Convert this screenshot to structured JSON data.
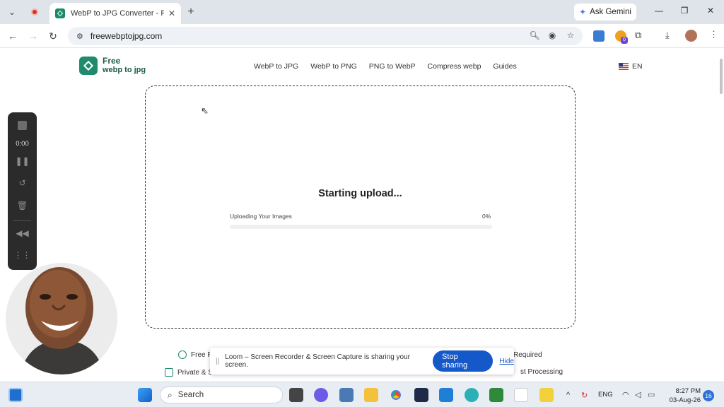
{
  "browser": {
    "tab_title": "WebP to JPG Converter - Free, f",
    "tab_close": "✕",
    "new_tab": "+",
    "gemini_label": "Ask Gemini",
    "url": "freewebptojpg.com",
    "window_controls": {
      "minimize": "—",
      "restore": "❐",
      "close": "✕"
    },
    "ext_badge": "0"
  },
  "site": {
    "logo_line1": "Free",
    "logo_line2": "webp to jpg",
    "nav": [
      "WebP to JPG",
      "WebP to PNG",
      "PNG to WebP",
      "Compress webp",
      "Guides"
    ],
    "lang": "EN"
  },
  "upload": {
    "title": "Starting upload...",
    "label": "Uploading Your Images",
    "percent_text": "0%",
    "progress": 0
  },
  "features": {
    "f1": "Free F",
    "f2": "Required",
    "f3": "Private & S",
    "f4": "st Processing"
  },
  "loom": {
    "time": "0:00",
    "share_text": "Loom – Screen Recorder & Screen Capture is sharing your screen.",
    "stop_label": "Stop sharing",
    "hide_label": "Hide"
  },
  "taskbar": {
    "search": "Search",
    "lang": "ENG",
    "time": "8:27 PM",
    "date": "03-Aug-26",
    "notifications": "16"
  },
  "colors": {
    "brand": "#1f8a6c",
    "stop": "#1558c9"
  }
}
